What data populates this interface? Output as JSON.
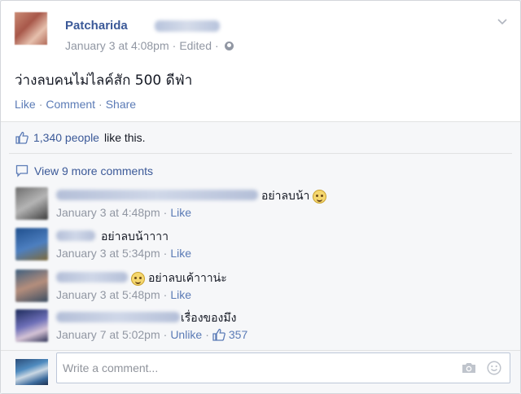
{
  "post": {
    "author": "Patcharida",
    "date": "January 3 at 4:08pm",
    "edited": "Edited",
    "separator": "·",
    "text": "ว่างลบคนไม่ไลค์สัก 500 ดีฟ่า",
    "actions": {
      "like": "Like",
      "comment": "Comment",
      "share": "Share"
    }
  },
  "likes": {
    "count": "1,340 people",
    "suffix": "like this."
  },
  "more_comments": "View 9 more comments",
  "comments": [
    {
      "text": "อย่าลบน้า",
      "time": "January 3 at 4:48pm",
      "like": "Like"
    },
    {
      "text": "อย่าลบน้าาาา",
      "time": "January 3 at 5:34pm",
      "like": "Like"
    },
    {
      "text": "อย่าลบเค้าาาน่ะ",
      "time": "January 3 at 5:48pm",
      "like": "Like"
    },
    {
      "text": "เรื่องของมึง",
      "time": "January 7 at 5:02pm",
      "like": "Unlike",
      "like_count": "357"
    }
  ],
  "composer": {
    "placeholder": "Write a comment..."
  },
  "colors": {
    "link": "#3b5998",
    "meta": "#9197a3",
    "background": "#f6f7f9"
  }
}
